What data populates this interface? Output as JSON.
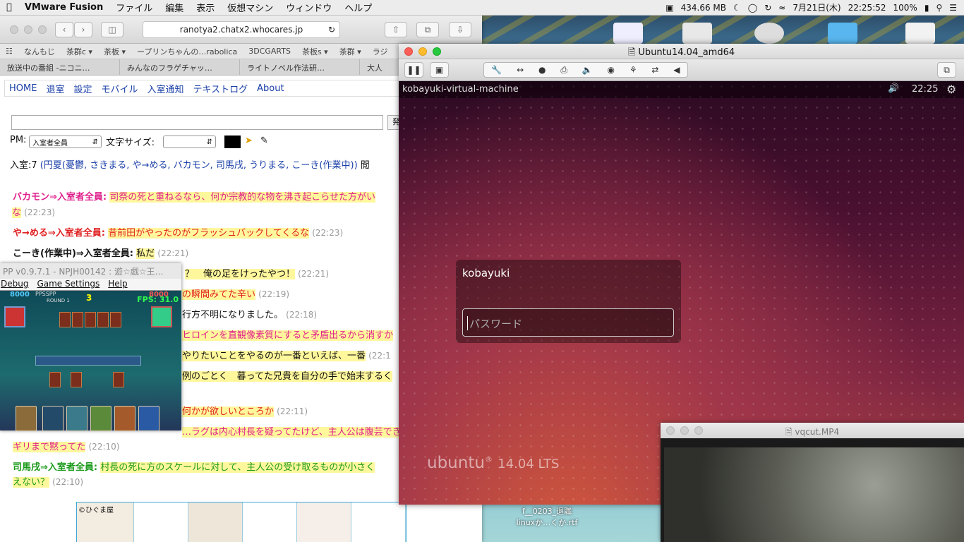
{
  "menubar": {
    "app": "VMware Fusion",
    "items": [
      "ファイル",
      "編集",
      "表示",
      "仮想マシン",
      "ウィンドウ",
      "ヘルプ"
    ],
    "memory": "434.66 MB",
    "date": "7月21日(木)",
    "time": "22:25:52",
    "battery": "100%"
  },
  "browser": {
    "url": "ranotya2.chatx2.whocares.jp",
    "bookmarks": [
      "なんもじ",
      "茶群c ▾",
      "茶板 ▾",
      "ープリンちゃんの…rabolica",
      "3DCGARTS",
      "茶板s ▾",
      "茶群 ▾",
      "ラジ"
    ],
    "tabs": [
      "放送中の番組 -ニコニ…",
      "みんなのフラゲチャッ…",
      "ライトノベル作法研…",
      "大人"
    ]
  },
  "chat": {
    "nav": [
      "HOME",
      "退室",
      "設定",
      "モバイル",
      "入室通知",
      "テキストログ",
      "About"
    ],
    "send": "発",
    "pm_label": "PM:",
    "pm_value": "入室者全員",
    "fontsize_label": "文字サイズ:",
    "room_prefix": "入室:7",
    "room_users": "(円夏(憂鬱, さきまる, や→める, バカモン, 司馬戌, うりまる, こーき(作業中))",
    "room_suffix": "閲",
    "messages": [
      {
        "who": "バカモン⇒入室者全員:",
        "text": "司祭の死と重ねるなら、何か宗教的な物を沸き起こらせた方がい",
        "cont": "な",
        "ts": "(22:23)",
        "color": "#e0208c"
      },
      {
        "who": "や→める⇒入室者全員:",
        "text": "昔前田がやったのがフラッシュバックしてくるな",
        "ts": "(22:23)",
        "color": "#e02020"
      },
      {
        "who": "こーき(作業中)⇒入室者全員:",
        "text": "私だ",
        "ts": "(22:21)",
        "color": "#111111"
      },
      {
        "text": "？　俺の足をけったやつ！",
        "ts": "(22:21)",
        "color": "#111111"
      },
      {
        "text": "の瞬間みてた辛い",
        "ts": "(22:19)",
        "color": "#e02020"
      },
      {
        "text": "行方不明になりました。",
        "ts": "(22:18)",
        "color": "#111111"
      },
      {
        "text": "ヒロインを直観像素質にすると矛盾出るから消すか",
        "color": "#e0208c"
      },
      {
        "text": "やりたいことをやるのが一番といえば、一番",
        "ts": "(22:1",
        "color": "#111111"
      },
      {
        "text": "例のごとく　暮ってた兄貴を自分の手で始末するく",
        "color": "#111111"
      },
      {
        "text": "何かが欲しいところか",
        "ts": "(22:11)",
        "color": "#e02020"
      },
      {
        "text": "…ラグは内心村長を疑ってたけど、主人公は腹芸できん",
        "color": "#e0208c"
      },
      {
        "text": "ギリまで黙ってた",
        "ts": "(22:10)",
        "color": "#e0208c"
      },
      {
        "who": "司馬戌⇒入室者全員:",
        "text": "村長の死に方のスケールに対して、主人公の受け取るものが小さく",
        "cont": "えない？",
        "ts": "(22:10)",
        "color": "#1a9a1a"
      }
    ],
    "ad_copyright": "©ひぐま屋"
  },
  "ppsspp": {
    "title": "PP v0.9.7.1 - NPJH00142 : 遊☆戯☆王…",
    "menu": [
      "Debug",
      "Game Settings",
      "Help"
    ],
    "fps": "FPS: 31.0",
    "lp_left": "8000",
    "lp_right": "8000",
    "hud_left": "PPSSPP",
    "turn": "3",
    "round": "ROUND 1"
  },
  "vm": {
    "title": "Ubuntu14.04_amd64",
    "hostname": "kobayuki-virtual-machine",
    "clock": "22:25",
    "username": "kobayuki",
    "password_placeholder": "パスワード",
    "distro": "ubuntu",
    "version": "14.04 LTS"
  },
  "desktop": {
    "file_label_1": "f__0203_退職",
    "file_label_2": "linuxか…くか.rtf"
  },
  "video": {
    "title": "vqcut.MP4"
  }
}
